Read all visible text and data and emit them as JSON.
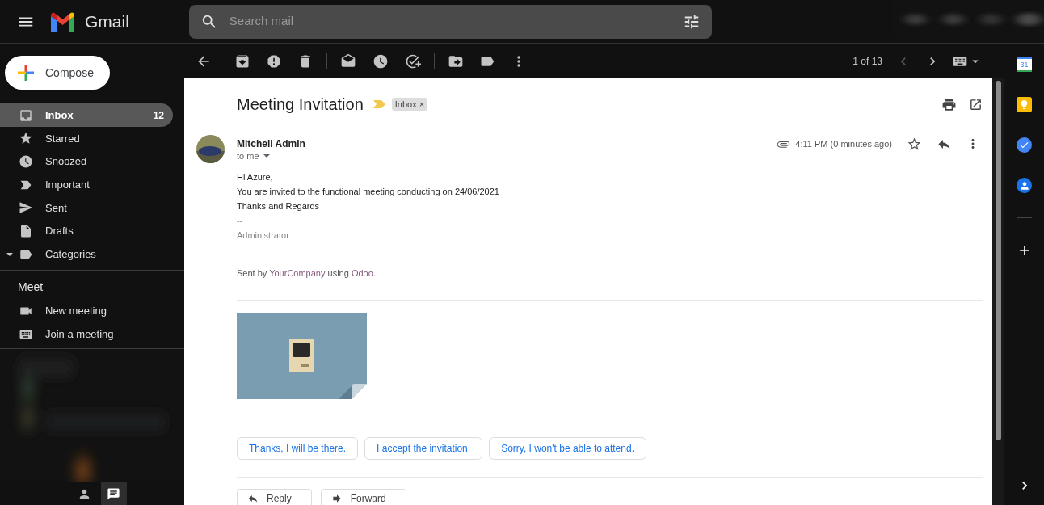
{
  "header": {
    "app_name": "Gmail",
    "search": {
      "placeholder": "Search mail"
    }
  },
  "sidebar": {
    "compose": "Compose",
    "items": [
      {
        "label": "Inbox",
        "count": "12",
        "selected": true,
        "kind": "inbox"
      },
      {
        "label": "Starred",
        "selected": false,
        "kind": "star"
      },
      {
        "label": "Snoozed",
        "selected": false,
        "kind": "clock"
      },
      {
        "label": "Important",
        "selected": false,
        "kind": "important"
      },
      {
        "label": "Sent",
        "selected": false,
        "kind": "send"
      },
      {
        "label": "Drafts",
        "selected": false,
        "kind": "file"
      },
      {
        "label": "Categories",
        "selected": false,
        "kind": "categories"
      }
    ],
    "meet": {
      "title": "Meet",
      "items": [
        {
          "label": "New meeting",
          "kind": "video"
        },
        {
          "label": "Join a meeting",
          "kind": "keyboard"
        }
      ]
    },
    "bottom_tabs": [
      {
        "kind": "person",
        "selected": false
      },
      {
        "kind": "chat",
        "selected": true
      }
    ]
  },
  "toolbar": {
    "pager": {
      "text": "1 of 13",
      "prev_disabled": true,
      "next_disabled": false
    }
  },
  "email": {
    "subject": "Meeting Invitation",
    "important": true,
    "labels": [
      {
        "text": "Inbox",
        "remove": "×"
      }
    ],
    "sender": "Mitchell Admin",
    "recipient": "to me",
    "time": "4:11 PM (0 minutes ago)",
    "has_attachment": true,
    "starred": false,
    "body": [
      {
        "text": "Hi Azure,",
        "muted": false
      },
      {
        "text": "You are invited to the functional meeting conducting on 24/06/2021",
        "muted": false
      },
      {
        "text": "Thanks and Regards",
        "muted": false
      },
      {
        "text": "--",
        "muted": true
      },
      {
        "text": "Administrator",
        "muted": true
      }
    ],
    "footer": [
      {
        "kind": "text",
        "text": "Sent by "
      },
      {
        "kind": "link",
        "text": "YourCompany"
      },
      {
        "kind": "text",
        "text": " using "
      },
      {
        "kind": "link",
        "text": "Odoo"
      },
      {
        "kind": "text",
        "text": "."
      }
    ],
    "smart_replies": [
      "Thanks, I will be there.",
      "I accept the invitation.",
      "Sorry, I won't be able to attend."
    ],
    "actions": [
      {
        "label": "Reply",
        "kind": "reply"
      },
      {
        "label": "Forward",
        "kind": "forward"
      }
    ]
  },
  "right_rail": {
    "calendar_day": "31"
  }
}
